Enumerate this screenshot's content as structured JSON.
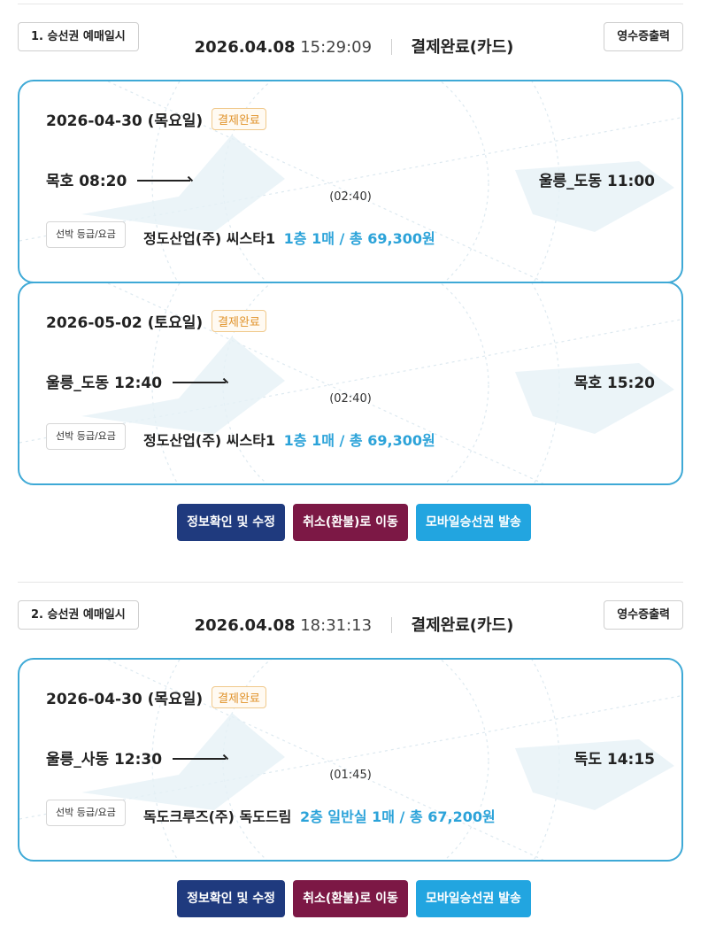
{
  "bookings": [
    {
      "label": "1. 승선권 예매일시",
      "date": "2026.04.08",
      "time": "15:29:09",
      "status": "결제완료(카드)",
      "receipt": "영수증출력",
      "tickets": [
        {
          "date": "2026-04-30 (목요일)",
          "badge": "결제완료",
          "from": "목호 08:20",
          "to": "울릉_도동 11:00",
          "duration": "(02:40)",
          "grade_btn": "선박 등급/요금",
          "ship": "정도산업(주) 씨스타1",
          "fare": "1층 1매 / 총 69,300원"
        },
        {
          "date": "2026-05-02 (토요일)",
          "badge": "결제완료",
          "from": "울릉_도동 12:40",
          "to": "목호 15:20",
          "duration": "(02:40)",
          "grade_btn": "선박 등급/요금",
          "ship": "정도산업(주) 씨스타1",
          "fare": "1층 1매 / 총 69,300원"
        }
      ],
      "actions": {
        "info": "정보확인 및 수정",
        "cancel": "취소(환불)로 이동",
        "mobile": "모바일승선권 발송"
      }
    },
    {
      "label": "2. 승선권 예매일시",
      "date": "2026.04.08",
      "time": "18:31:13",
      "status": "결제완료(카드)",
      "receipt": "영수증출력",
      "tickets": [
        {
          "date": "2026-04-30 (목요일)",
          "badge": "결제완료",
          "from": "울릉_사동 12:30",
          "to": "독도 14:15",
          "duration": "(01:45)",
          "grade_btn": "선박 등급/요금",
          "ship": "독도크루즈(주) 독도드림",
          "fare": "2층 일반실 1매 / 총 67,200원"
        }
      ],
      "actions": {
        "info": "정보확인 및 수정",
        "cancel": "취소(환불)로 이동",
        "mobile": "모바일승선권 발송"
      }
    }
  ],
  "colors": {
    "accent": "#2ca3d9",
    "border": "#3ea9d6",
    "badge": "#e0922a",
    "info_btn": "#1f3a7e",
    "cancel_btn": "#7c1845",
    "mobile_btn": "#22a5e0"
  }
}
